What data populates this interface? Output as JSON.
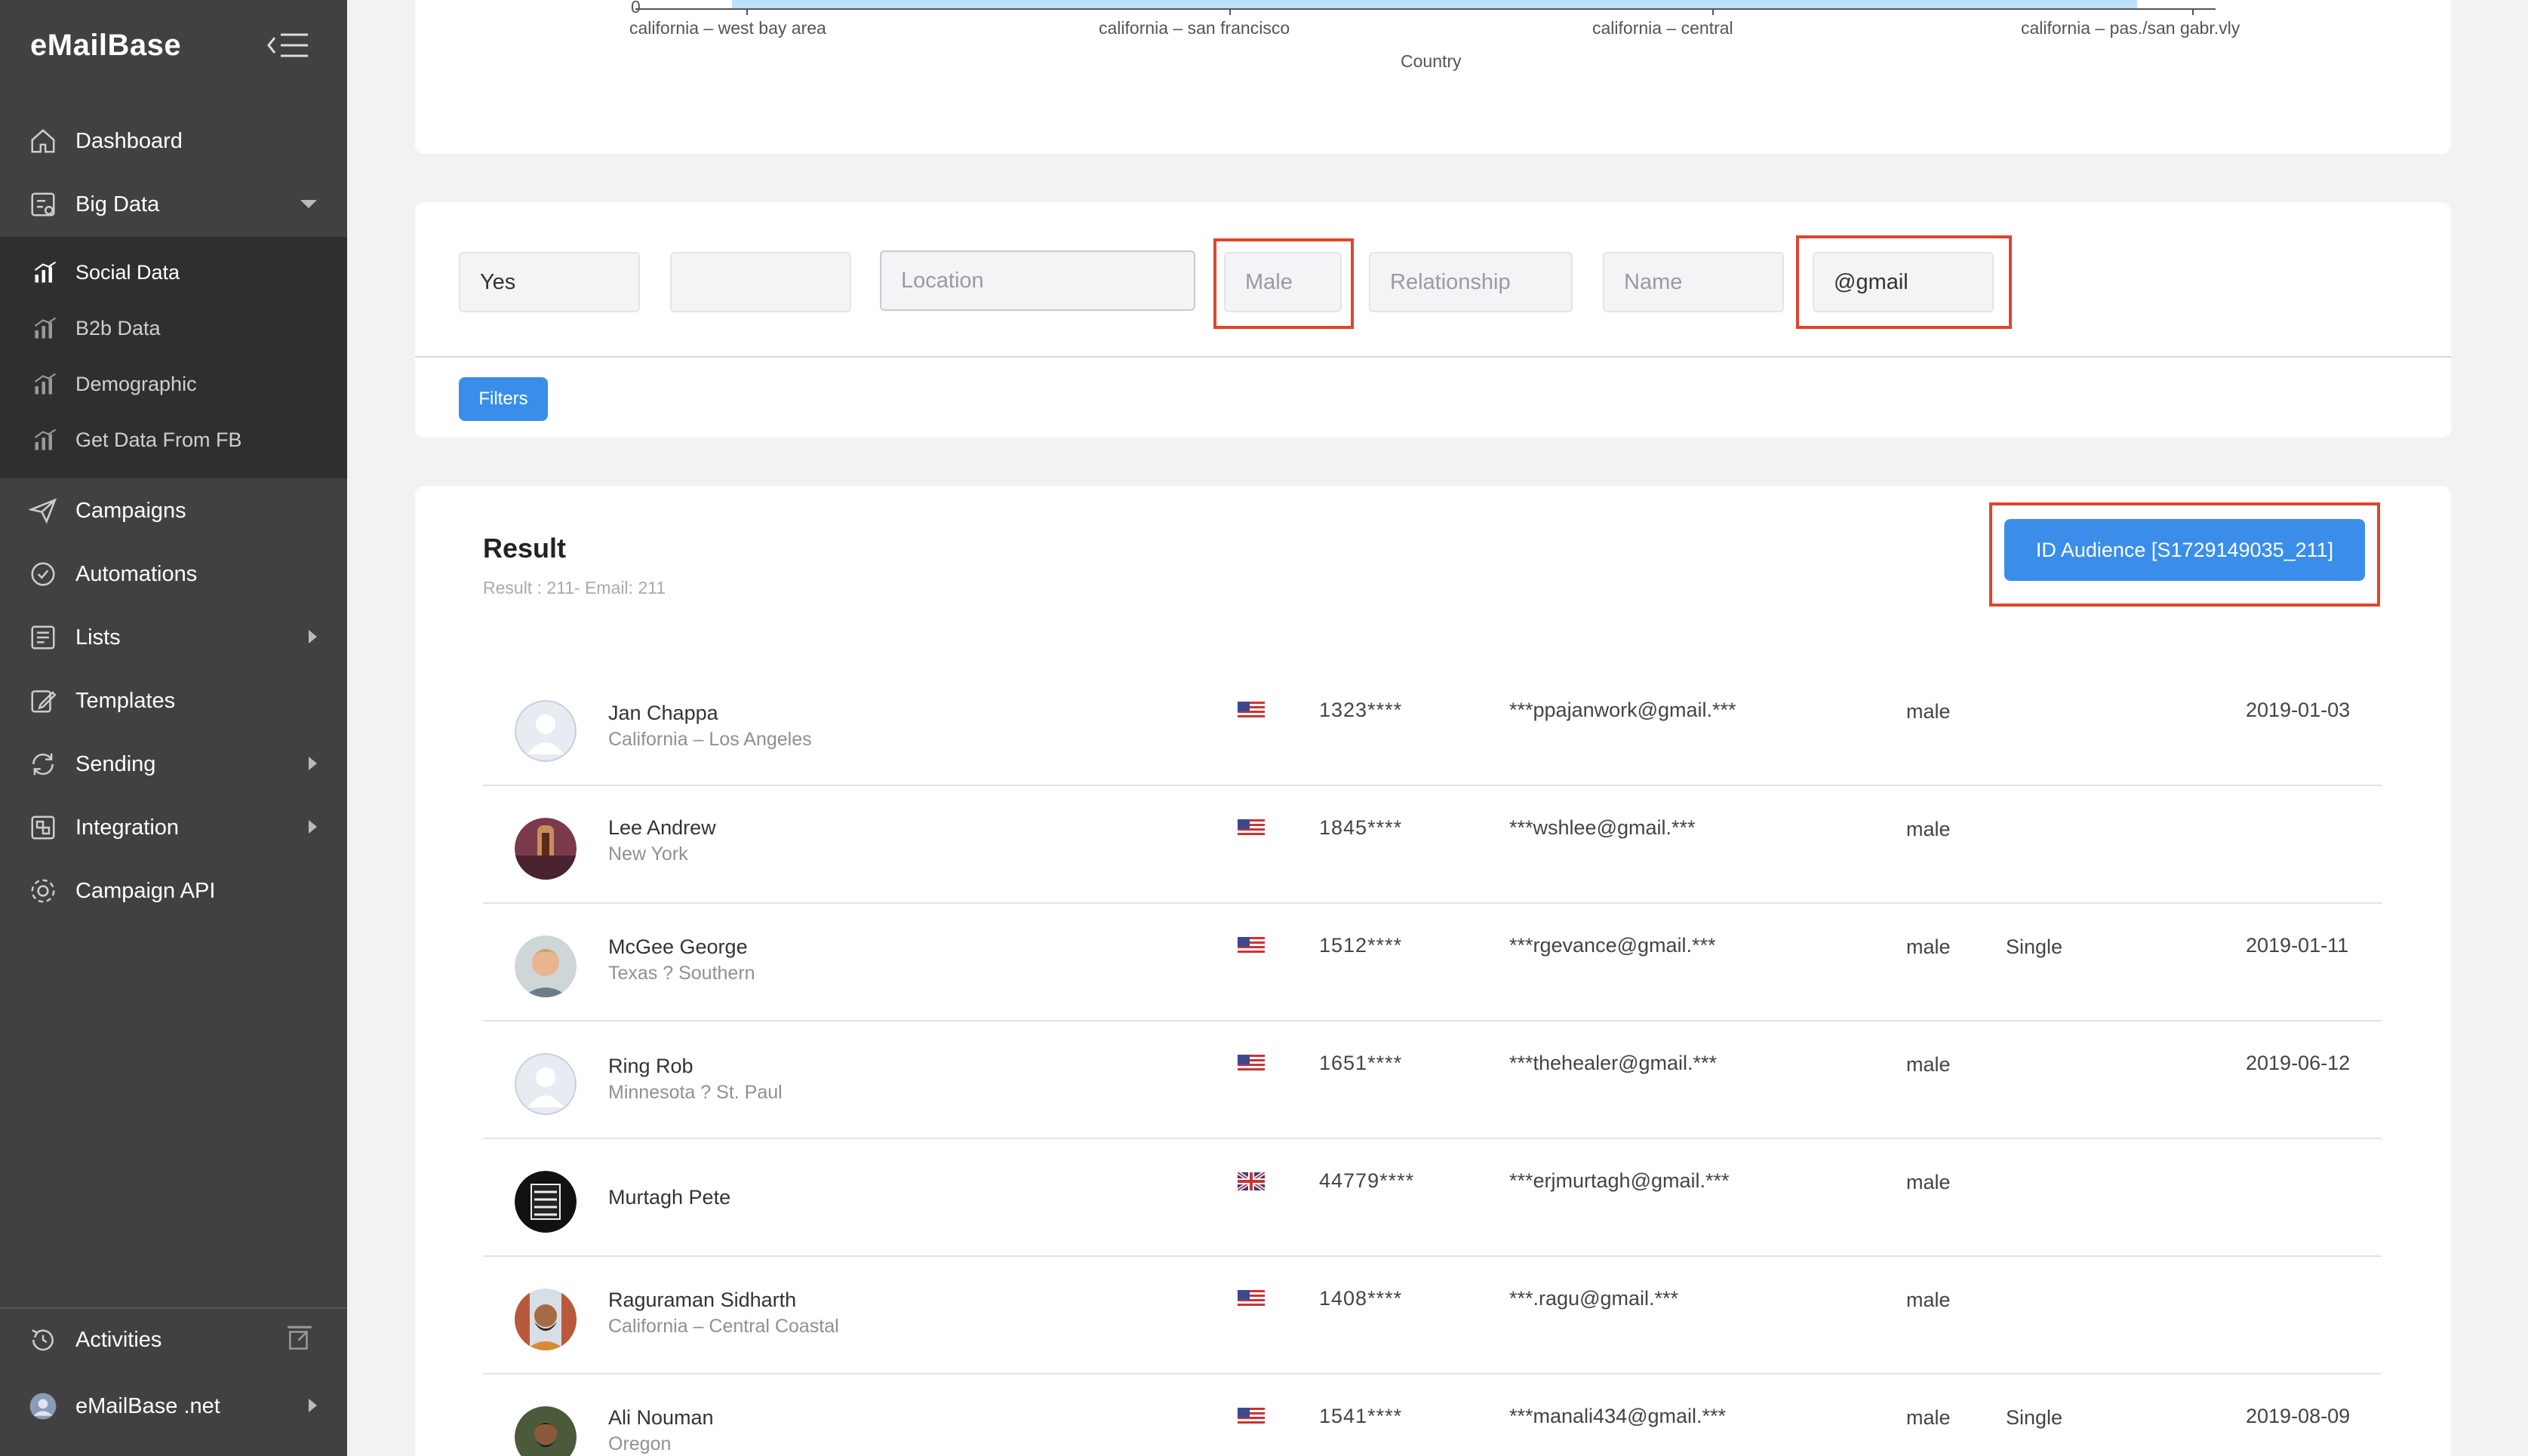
{
  "app": {
    "brand": "eMailBase"
  },
  "sidebar": {
    "items": [
      {
        "label": "Dashboard",
        "icon": "home-icon"
      },
      {
        "label": "Big Data",
        "icon": "data-icon"
      },
      {
        "label": "Campaigns",
        "icon": "send-icon"
      },
      {
        "label": "Automations",
        "icon": "check-circle-icon"
      },
      {
        "label": "Lists",
        "icon": "list-icon"
      },
      {
        "label": "Templates",
        "icon": "edit-icon"
      },
      {
        "label": "Sending",
        "icon": "sync-icon"
      },
      {
        "label": "Integration",
        "icon": "integration-icon"
      },
      {
        "label": "Campaign API",
        "icon": "api-icon"
      }
    ],
    "submenu": [
      {
        "label": "Social Data"
      },
      {
        "label": "B2b Data"
      },
      {
        "label": "Demographic"
      },
      {
        "label": "Get Data From FB"
      }
    ],
    "activities_label": "Activities",
    "account_label": "eMailBase .net"
  },
  "chart_data": {
    "type": "bar",
    "categories": [
      "california – west bay area",
      "california – san francisco",
      "california – central",
      "california – pas./san gabr.vly"
    ],
    "xlabel": "Country",
    "y_tick_visible": "0"
  },
  "filters": {
    "field1_value": "Yes",
    "field2_value": "",
    "location_placeholder": "Location",
    "gender_placeholder": "Male",
    "relationship_placeholder": "Relationship",
    "name_placeholder": "Name",
    "email_value": "@gmail",
    "filters_button": "Filters"
  },
  "result": {
    "title": "Result",
    "summary": "Result : 211- Email: 211",
    "audience_button": "ID Audience [S1729149035_211]",
    "rows": [
      {
        "name": "Jan Chappa",
        "location": "California – Los Angeles",
        "flag": "us",
        "phone": "1323****",
        "email": "***ppajanwork@gmail.***",
        "gender": "male",
        "relationship": "",
        "date": "2019-01-03"
      },
      {
        "name": "Lee Andrew",
        "location": "New York",
        "flag": "us",
        "phone": "1845****",
        "email": "***wshlee@gmail.***",
        "gender": "male",
        "relationship": "",
        "date": ""
      },
      {
        "name": "McGee George",
        "location": "Texas ? Southern",
        "flag": "us",
        "phone": "1512****",
        "email": "***rgevance@gmail.***",
        "gender": "male",
        "relationship": "Single",
        "date": "2019-01-11"
      },
      {
        "name": "Ring Rob",
        "location": "Minnesota ? St. Paul",
        "flag": "us",
        "phone": "1651****",
        "email": "***thehealer@gmail.***",
        "gender": "male",
        "relationship": "",
        "date": "2019-06-12"
      },
      {
        "name": "Murtagh Pete",
        "location": "",
        "flag": "uk",
        "phone": "44779****",
        "email": "***erjmurtagh@gmail.***",
        "gender": "male",
        "relationship": "",
        "date": ""
      },
      {
        "name": "Raguraman Sidharth",
        "location": "California – Central Coastal",
        "flag": "us",
        "phone": "1408****",
        "email": "***.ragu@gmail.***",
        "gender": "male",
        "relationship": "",
        "date": ""
      },
      {
        "name": "Ali Nouman",
        "location": "Oregon",
        "flag": "us",
        "phone": "1541****",
        "email": "***manali434@gmail.***",
        "gender": "male",
        "relationship": "Single",
        "date": "2019-08-09"
      }
    ]
  },
  "colors": {
    "sidebar": "#414141",
    "submenu": "#2f2f2f",
    "accent": "#3a8eea",
    "highlight": "#e0452d"
  }
}
